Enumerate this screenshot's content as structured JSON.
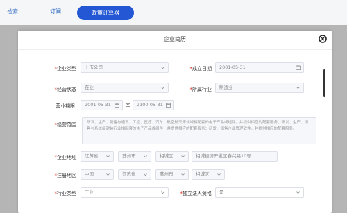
{
  "nav": {
    "search": "检索",
    "subscribe": "订阅",
    "policy_calculator": "政策计算器"
  },
  "modal": {
    "title": "企业简历"
  },
  "form": {
    "enterprise_type": {
      "label": "企业类型",
      "value": "上市公司"
    },
    "established_date": {
      "label": "成立日期",
      "value": "2001-05-31"
    },
    "business_status": {
      "label": "经营状态",
      "value": "在业"
    },
    "industry": {
      "label": "所属行业",
      "value": "制造业"
    },
    "business_term": {
      "label": "营业期限",
      "start": "2001-05-31",
      "to": "至",
      "end": "2100-05-31"
    },
    "business_scope": {
      "label": "经营范围",
      "value": "研发、生产、销售与通讯、工控、医疗、汽车、航空航天等领域相配套的电子产品或组件，并提供相应的配套服务；研发、生产、销售与系统级封装行业相配套的电子产品或组件，并提供相应的配套服务；研发、销售企业管理软件，并提供相应的配套服务。"
    },
    "enterprise_address": {
      "label": "企业地址",
      "province": "江苏省",
      "city": "苏州市",
      "district": "相城区",
      "detail": "相城经济开发区春兴路10号"
    },
    "registered_region": {
      "label": "注册地区",
      "country": "中国",
      "province": "江苏省",
      "city": "苏州市",
      "district": "相城区"
    },
    "industry_category": {
      "label": "行业类型",
      "value": "工业"
    },
    "is_legal_person_shareholder": {
      "label": "独立法人资格",
      "value": "是"
    }
  },
  "colors": {
    "accent": "#2357d3",
    "required": "#d9241c"
  },
  "icons": [
    "close-icon",
    "chevron-down-icon",
    "calendar-icon"
  ]
}
